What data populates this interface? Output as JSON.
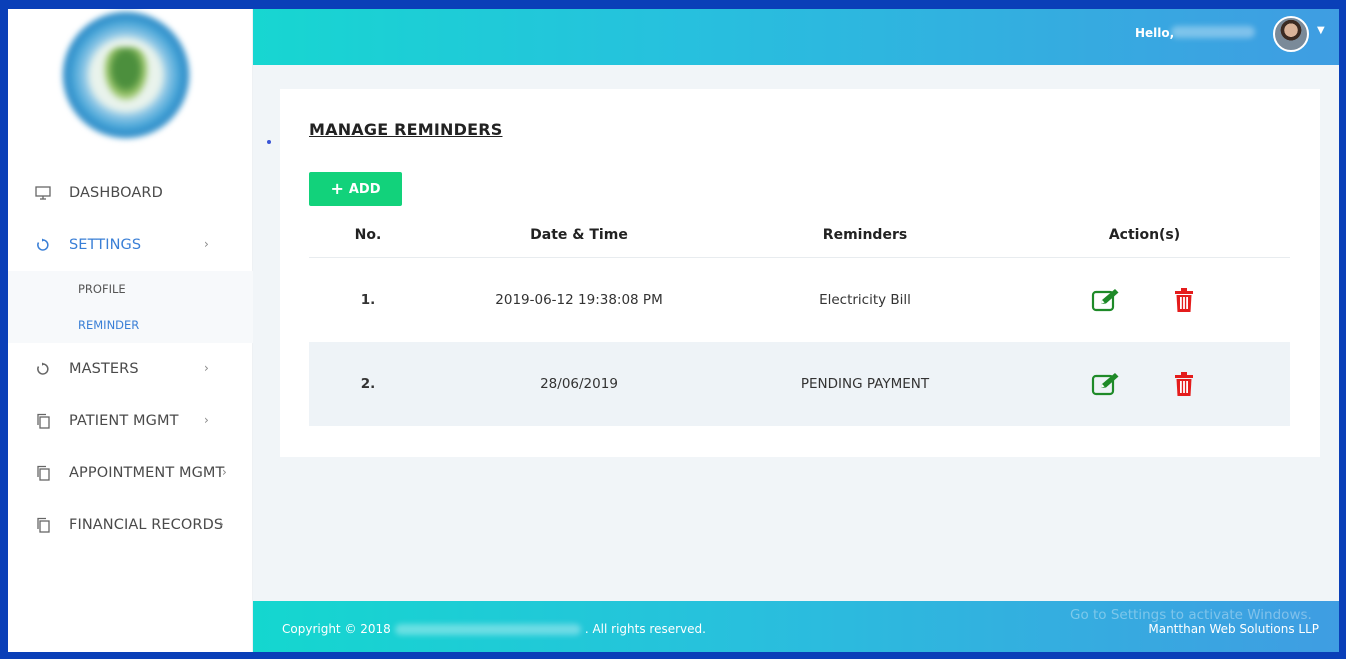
{
  "sidebar": {
    "items": [
      {
        "label": "DASHBOARD",
        "icon": "monitor-icon"
      },
      {
        "label": "SETTINGS",
        "icon": "refresh-icon",
        "sub": [
          {
            "label": "PROFILE"
          },
          {
            "label": "REMINDER"
          }
        ]
      },
      {
        "label": "MASTERS",
        "icon": "refresh-icon"
      },
      {
        "label": "PATIENT MGMT",
        "icon": "copy-icon"
      },
      {
        "label": "APPOINTMENT MGMT",
        "icon": "copy-icon"
      },
      {
        "label": "FINANCIAL RECORDS",
        "icon": "copy-icon"
      }
    ]
  },
  "header": {
    "greeting": "Hello,"
  },
  "main": {
    "title": "MANAGE REMINDERS",
    "add_label": "ADD",
    "table": {
      "columns": [
        "No.",
        "Date & Time",
        "Reminders",
        "Action(s)"
      ],
      "rows": [
        {
          "no": "1.",
          "datetime": "2019-06-12 19:38:08 PM",
          "reminder": "Electricity Bill"
        },
        {
          "no": "2.",
          "datetime": "28/06/2019",
          "reminder": "PENDING PAYMENT"
        }
      ]
    }
  },
  "footer": {
    "copyright_prefix": "Copyright © 2018",
    "copyright_suffix": ". All rights reserved.",
    "company": "Mantthan Web Solutions LLP",
    "watermark": "Go to Settings to activate Windows."
  },
  "colors": {
    "accent": "#3a7fd6",
    "add_button": "#12d27b",
    "edit_icon": "#1e8a28",
    "delete_icon": "#e41c1c"
  }
}
